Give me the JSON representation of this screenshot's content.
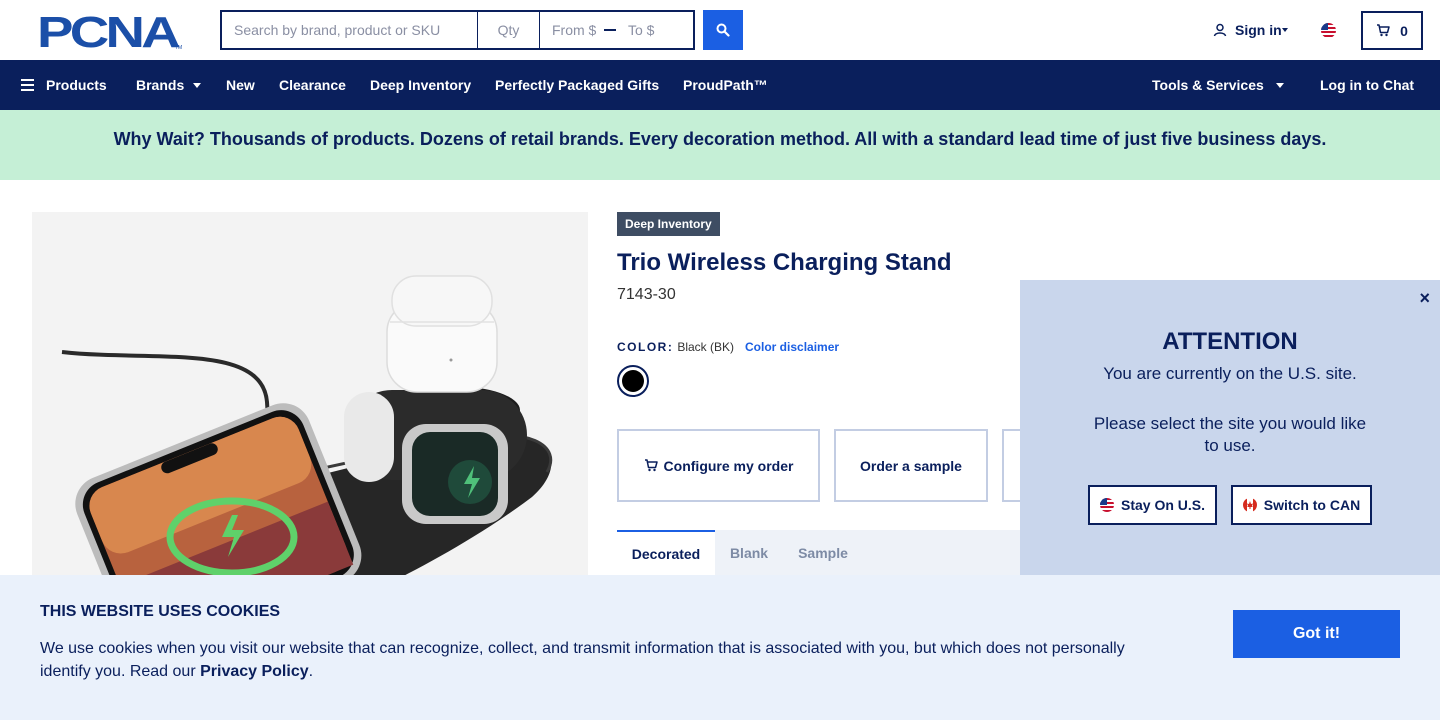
{
  "header": {
    "logo_text": "PCNA",
    "search": {
      "main_placeholder": "Search by brand, product or SKU",
      "qty_placeholder": "Qty",
      "from_placeholder": "From $",
      "to_placeholder": "To $"
    },
    "signin_label": "Sign in",
    "cart_count": "0"
  },
  "nav": {
    "products": "Products",
    "brands": "Brands",
    "new": "New",
    "clearance": "Clearance",
    "deep_inventory": "Deep Inventory",
    "gifts": "Perfectly Packaged Gifts",
    "proudpath": "ProudPath™",
    "tools": "Tools & Services",
    "chat": "Log in to Chat"
  },
  "promo": {
    "text": "Why Wait? Thousands of products. Dozens of retail brands. Every decoration method. All with a standard lead time of just five business days."
  },
  "product": {
    "badge": "Deep Inventory",
    "title": "Trio Wireless Charging Stand",
    "sku": "7143-30",
    "color_label": "COLOR:",
    "color_value": "Black (BK)",
    "color_disclaimer": "Color disclaimer",
    "swatch_color": "#000000",
    "configure_label": "Configure my order",
    "sample_label": "Order a sample",
    "tabs": [
      "Decorated",
      "Blank",
      "Sample"
    ]
  },
  "popup": {
    "title": "ATTENTION",
    "message1": "You are currently on the U.S. site.",
    "message2": "Please select the site you would like to use.",
    "stay_label": "Stay On U.S.",
    "switch_label": "Switch to CAN",
    "close_symbol": "×"
  },
  "cookie": {
    "title": "THIS WEBSITE USES COOKIES",
    "text_before": "We use cookies when you visit our website that can recognize, collect, and transmit information that is associated with you, but which does not personally identify you. Read our ",
    "link_text": "Privacy Policy",
    "text_after": ".",
    "button_label": "Got it!"
  },
  "colors": {
    "navy": "#0a1f5c",
    "accent_blue": "#1b5fe3",
    "promo_green": "#c5efd6",
    "popup_bg": "#c9d6ec",
    "cookie_bg": "#eaf1fb"
  }
}
